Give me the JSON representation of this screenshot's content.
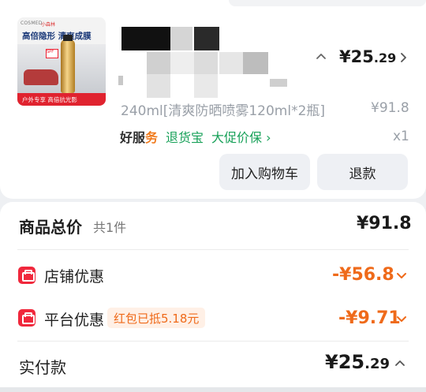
{
  "product": {
    "thumbnail": {
      "brand_text": "COSMED",
      "brand_text_2": "小森林",
      "headline": "高倍隐形 清爽成膜",
      "sticker_text": "SPF",
      "banner": "户外专享 高倍抗光影"
    },
    "price": {
      "currency": "¥",
      "integer": "25",
      "decimal": ".29"
    },
    "variant": "240ml[清爽防晒喷雾120ml*2瓶]",
    "unit_price": "¥91.8",
    "services": {
      "good_prefix": "好服",
      "good_suffix": "务",
      "items": [
        "退货宝",
        "大促价保 ›"
      ]
    },
    "quantity": "x1",
    "buttons": {
      "add_to_cart": "加入购物车",
      "refund": "退款"
    }
  },
  "summary": {
    "total": {
      "label": "商品总价",
      "count": "共1件",
      "value": "¥91.8"
    },
    "store_discount": {
      "label": "店铺优惠",
      "value": "-¥56.8"
    },
    "platform_discount": {
      "label": "平台优惠",
      "tag": "红包已抵5.18元",
      "value": "-¥9.71"
    },
    "paid": {
      "label": "实付款",
      "currency": "¥",
      "integer": "25",
      "decimal": ".29"
    }
  },
  "colors": {
    "accent_orange": "#ef6a1a",
    "brand_red": "#f0283c",
    "service_green": "#18a159"
  },
  "icons": [
    "chevron-up-icon",
    "chevron-right-icon",
    "store-coupon-icon",
    "platform-coupon-icon",
    "chevron-down-icon"
  ]
}
